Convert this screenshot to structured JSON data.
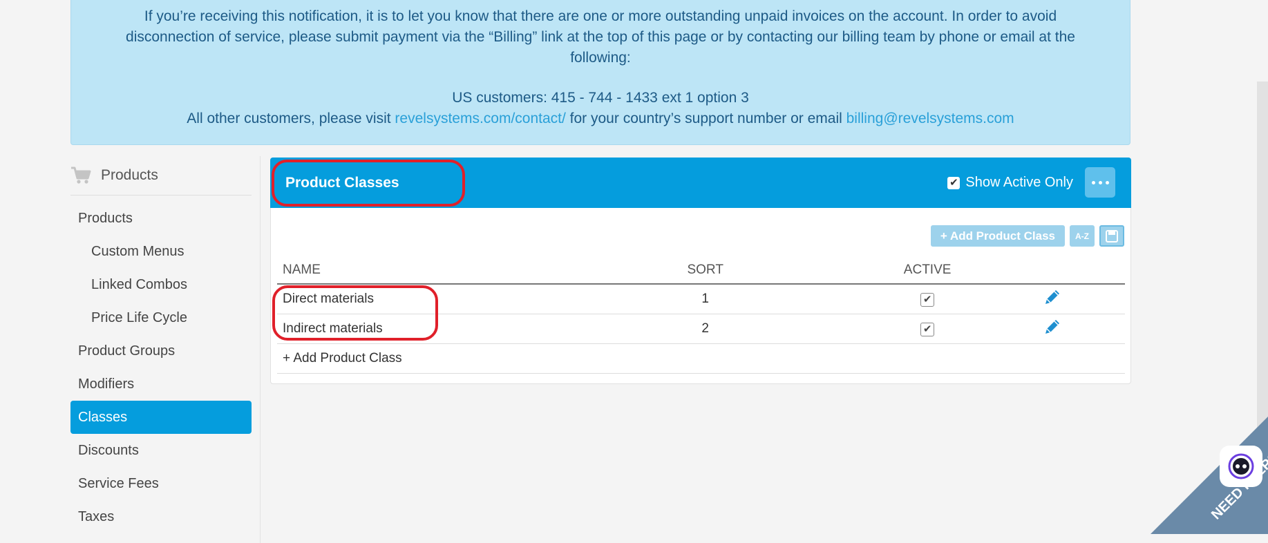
{
  "notice": {
    "line1": "If you’re receiving this notification, it is to let you know that there are one or more outstanding unpaid invoices on the account. In order to avoid disconnection of service, please submit payment via the “Billing” link at the top of this page or by contacting our billing team by phone or email at the following:",
    "us_line": "US customers: 415 - 744 - 1433 ext 1 option 3",
    "other_prefix": "All other customers, please visit ",
    "contact_link": "revelsystems.com/contact/",
    "other_mid": " for your country’s support number or email ",
    "email_link": "billing@revelsystems.com"
  },
  "sidebar": {
    "header": "Products",
    "items": [
      {
        "label": "Products"
      },
      {
        "label": "Custom Menus"
      },
      {
        "label": "Linked Combos"
      },
      {
        "label": "Price Life Cycle"
      },
      {
        "label": "Product Groups"
      },
      {
        "label": "Modifiers"
      },
      {
        "label": "Classes"
      },
      {
        "label": "Discounts"
      },
      {
        "label": "Service Fees"
      },
      {
        "label": "Taxes"
      }
    ],
    "active": "Classes"
  },
  "panel": {
    "title": "Product Classes",
    "show_active_label": "Show Active Only",
    "show_active_checked": true,
    "add_button": "+ Add Product Class",
    "az_button": "A-Z"
  },
  "table": {
    "headers": {
      "name": "NAME",
      "sort": "SORT",
      "active": "ACTIVE"
    },
    "rows": [
      {
        "name": "Direct materials",
        "sort": "1",
        "active": true
      },
      {
        "name": "Indirect materials",
        "sort": "2",
        "active": true
      }
    ],
    "add_row_label": "+ Add Product Class"
  },
  "help": {
    "label": "NEED HELP?"
  },
  "colors": {
    "accent": "#059ddd",
    "highlight": "#e0202a",
    "notice_bg": "#bde5f6"
  }
}
